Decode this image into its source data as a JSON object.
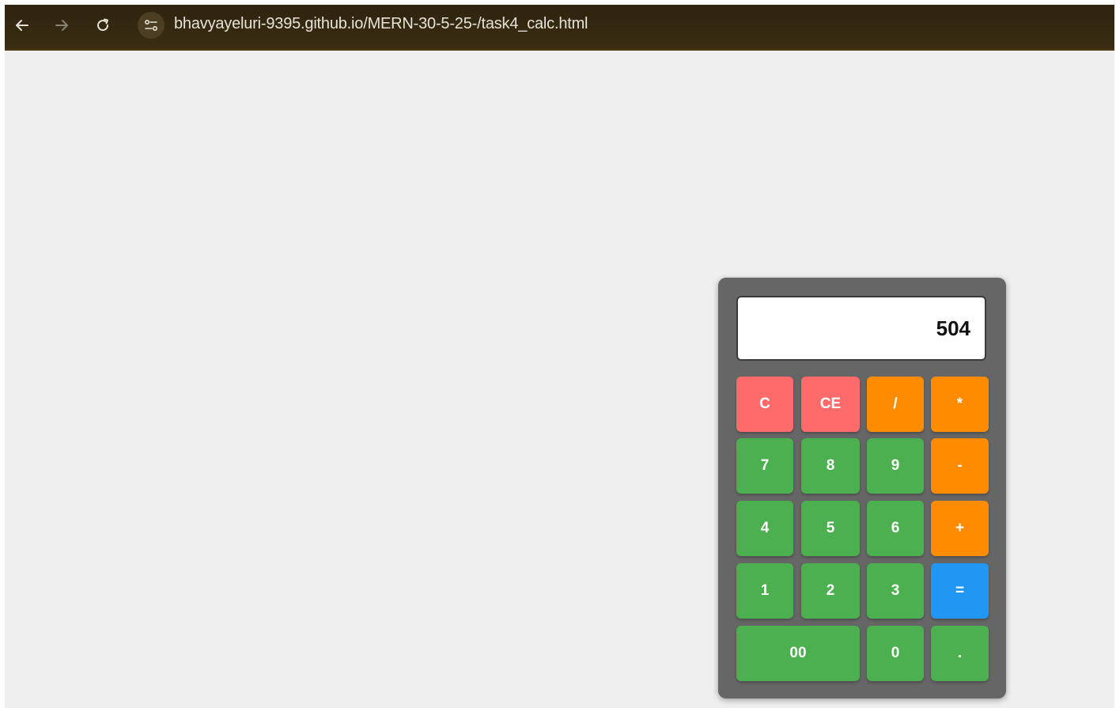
{
  "browser": {
    "url": "bhavyayeluri-9395.github.io/MERN-30-5-25-/task4_calc.html",
    "icons": {
      "back": "arrow-left-icon",
      "forward": "arrow-right-icon",
      "reload": "reload-icon",
      "site_info": "site-settings-icon"
    }
  },
  "calculator": {
    "display": "504",
    "keys": {
      "clear": "C",
      "clear_entry": "CE",
      "divide": "/",
      "multiply": "*",
      "seven": "7",
      "eight": "8",
      "nine": "9",
      "subtract": "-",
      "four": "4",
      "five": "5",
      "six": "6",
      "add": "+",
      "one": "1",
      "two": "2",
      "three": "3",
      "equals": "=",
      "double_zero": "00",
      "zero": "0",
      "decimal": "."
    },
    "colors": {
      "body": "#666666",
      "clear_keys": "#ff6b6b",
      "operator_keys": "#ff8c00",
      "number_keys": "#4caf50",
      "equals_key": "#2196f3"
    }
  }
}
